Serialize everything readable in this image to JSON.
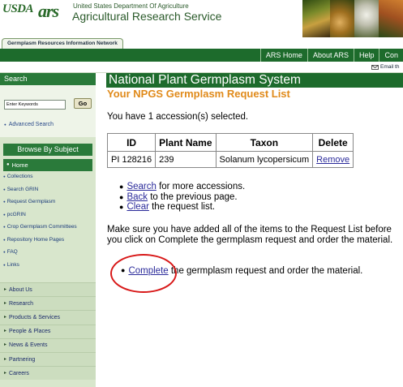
{
  "header": {
    "usda_logo": "USDA",
    "ars_logo": "ars",
    "department": "United States Department Of Agriculture",
    "agency": "Agricultural Research Service"
  },
  "tabs": {
    "grin": "Germplasm Resources Information Network"
  },
  "top_nav": [
    "ARS Home",
    "About ARS",
    "Help",
    "Con"
  ],
  "email_link": "Email th",
  "sidebar": {
    "search_header": "Search",
    "keyword_placeholder": "Enter Keywords",
    "go_label": "Go",
    "advanced_search": "Advanced Search",
    "browse_header": "Browse By Subject",
    "home": "Home",
    "links": [
      "Collections",
      "Search GRIN",
      "Request Germplasm",
      "pcGRIN",
      "Crop Germplasm Committees",
      "Repository Home Pages",
      "FAQ",
      "Links"
    ],
    "sections": [
      "About Us",
      "Research",
      "Products & Services",
      "People & Places",
      "News & Events",
      "Partnering",
      "Careers"
    ]
  },
  "main": {
    "title": "National Plant Germplasm System",
    "subtitle": "Your NPGS Germplasm Request List",
    "selected_text": "You have 1 accession(s) selected.",
    "table": {
      "headers": [
        "ID",
        "Plant Name",
        "Taxon",
        "Delete"
      ],
      "rows": [
        {
          "id": "PI 128216",
          "plant_name": "239",
          "taxon": "Solanum lycopersicum",
          "delete": "Remove"
        }
      ]
    },
    "actions": [
      {
        "link": "Search",
        "rest": " for more accessions."
      },
      {
        "link": "Back",
        "rest": " to the previous page."
      },
      {
        "link": "Clear",
        "rest": " the request list."
      }
    ],
    "instructions": "Make sure you have added all of the items to the Request List before you click on Complete the germplasm request and order the material.",
    "complete": {
      "link": "Complete",
      "rest": " the germplasm request and order the material."
    }
  },
  "colors": {
    "nav_green": "#1d6b2c",
    "subtitle_orange": "#e08a1a",
    "sidebar_bg": "#d8e6cc",
    "highlight_red": "#d81818"
  }
}
